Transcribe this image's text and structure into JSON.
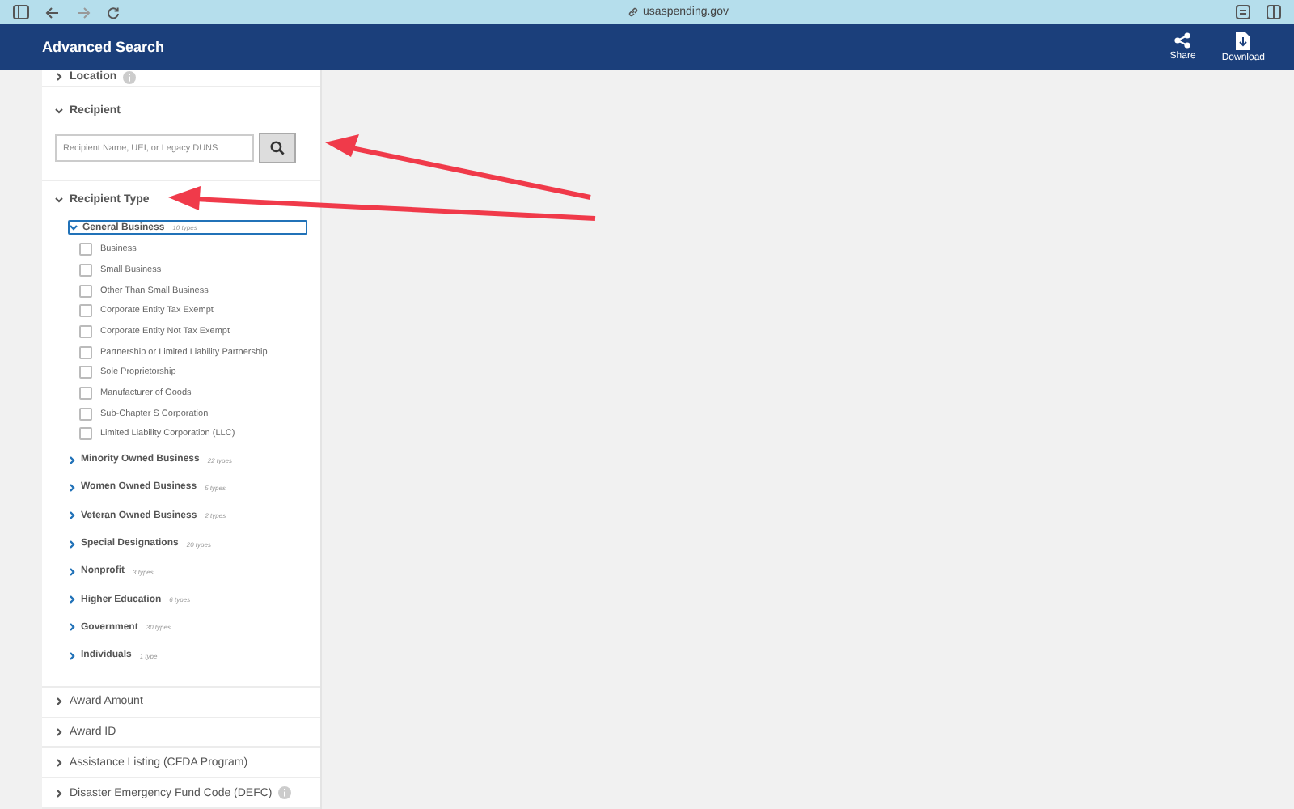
{
  "browser": {
    "url": "usaspending.gov"
  },
  "header": {
    "title": "Advanced Search",
    "actions": [
      {
        "kind": "share",
        "label": "Share"
      },
      {
        "kind": "download",
        "label": "Download"
      }
    ]
  },
  "location": {
    "label": "Location",
    "expanded": false
  },
  "recipient": {
    "label": "Recipient",
    "expanded": true,
    "search": {
      "placeholder": "Recipient Name, UEI, or Legacy DUNS"
    }
  },
  "recipient_type": {
    "label": "Recipient Type",
    "expanded": true,
    "groups": [
      {
        "label": "General Business",
        "count": "10 types",
        "expanded": true,
        "focused": true,
        "children": [
          {
            "label": "Business",
            "checked": false
          },
          {
            "label": "Small Business",
            "checked": false
          },
          {
            "label": "Other Than Small Business",
            "checked": false
          },
          {
            "label": "Corporate Entity Tax Exempt",
            "checked": false
          },
          {
            "label": "Corporate Entity Not Tax Exempt",
            "checked": false
          },
          {
            "label": "Partnership or Limited Liability Partnership",
            "checked": false
          },
          {
            "label": "Sole Proprietorship",
            "checked": false
          },
          {
            "label": "Manufacturer of Goods",
            "checked": false
          },
          {
            "label": "Sub-Chapter S Corporation",
            "checked": false
          },
          {
            "label": "Limited Liability Corporation (LLC)",
            "checked": false
          }
        ]
      },
      {
        "label": "Minority Owned Business",
        "count": "22 types",
        "expanded": false,
        "focused": false
      },
      {
        "label": "Women Owned Business",
        "count": "5 types",
        "expanded": false,
        "focused": false
      },
      {
        "label": "Veteran Owned Business",
        "count": "2 types",
        "expanded": false,
        "focused": false
      },
      {
        "label": "Special Designations",
        "count": "20 types",
        "expanded": false,
        "focused": false
      },
      {
        "label": "Nonprofit",
        "count": "3 types",
        "expanded": false,
        "focused": false
      },
      {
        "label": "Higher Education",
        "count": "6 types",
        "expanded": false,
        "focused": false
      },
      {
        "label": "Government",
        "count": "30 types",
        "expanded": false,
        "focused": false
      },
      {
        "label": "Individuals",
        "count": "1 type",
        "expanded": false,
        "focused": false
      }
    ]
  },
  "filters": [
    {
      "label": "Award Amount",
      "expanded": false,
      "info": false
    },
    {
      "label": "Award ID",
      "expanded": false,
      "info": false
    },
    {
      "label": "Assistance Listing (CFDA Program)",
      "expanded": false,
      "info": false
    },
    {
      "label": "Disaster Emergency Fund Code (DEFC)",
      "expanded": false,
      "info": true
    }
  ]
}
